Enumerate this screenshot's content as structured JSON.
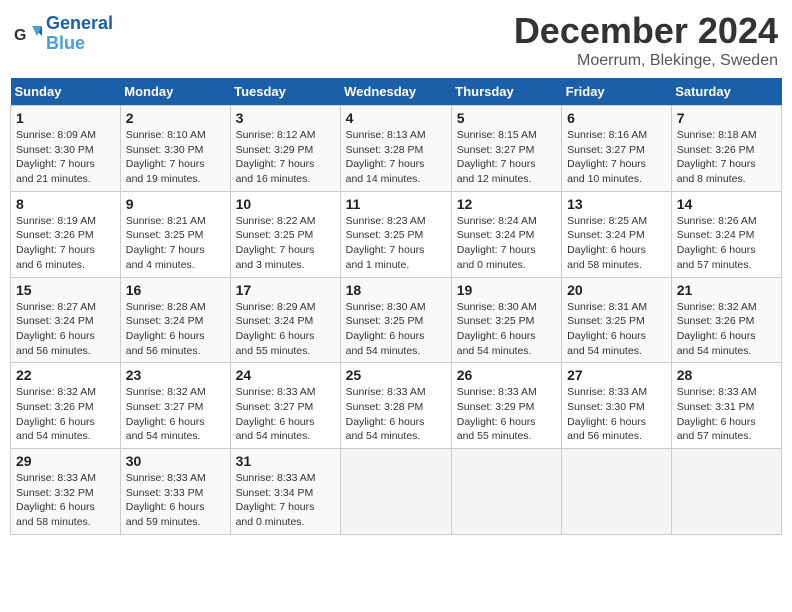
{
  "header": {
    "logo_line1": "General",
    "logo_line2": "Blue",
    "month": "December 2024",
    "location": "Moerrum, Blekinge, Sweden"
  },
  "columns": [
    "Sunday",
    "Monday",
    "Tuesday",
    "Wednesday",
    "Thursday",
    "Friday",
    "Saturday"
  ],
  "weeks": [
    [
      {
        "day": "1",
        "info": "Sunrise: 8:09 AM\nSunset: 3:30 PM\nDaylight: 7 hours\nand 21 minutes."
      },
      {
        "day": "2",
        "info": "Sunrise: 8:10 AM\nSunset: 3:30 PM\nDaylight: 7 hours\nand 19 minutes."
      },
      {
        "day": "3",
        "info": "Sunrise: 8:12 AM\nSunset: 3:29 PM\nDaylight: 7 hours\nand 16 minutes."
      },
      {
        "day": "4",
        "info": "Sunrise: 8:13 AM\nSunset: 3:28 PM\nDaylight: 7 hours\nand 14 minutes."
      },
      {
        "day": "5",
        "info": "Sunrise: 8:15 AM\nSunset: 3:27 PM\nDaylight: 7 hours\nand 12 minutes."
      },
      {
        "day": "6",
        "info": "Sunrise: 8:16 AM\nSunset: 3:27 PM\nDaylight: 7 hours\nand 10 minutes."
      },
      {
        "day": "7",
        "info": "Sunrise: 8:18 AM\nSunset: 3:26 PM\nDaylight: 7 hours\nand 8 minutes."
      }
    ],
    [
      {
        "day": "8",
        "info": "Sunrise: 8:19 AM\nSunset: 3:26 PM\nDaylight: 7 hours\nand 6 minutes."
      },
      {
        "day": "9",
        "info": "Sunrise: 8:21 AM\nSunset: 3:25 PM\nDaylight: 7 hours\nand 4 minutes."
      },
      {
        "day": "10",
        "info": "Sunrise: 8:22 AM\nSunset: 3:25 PM\nDaylight: 7 hours\nand 3 minutes."
      },
      {
        "day": "11",
        "info": "Sunrise: 8:23 AM\nSunset: 3:25 PM\nDaylight: 7 hours\nand 1 minute."
      },
      {
        "day": "12",
        "info": "Sunrise: 8:24 AM\nSunset: 3:24 PM\nDaylight: 7 hours\nand 0 minutes."
      },
      {
        "day": "13",
        "info": "Sunrise: 8:25 AM\nSunset: 3:24 PM\nDaylight: 6 hours\nand 58 minutes."
      },
      {
        "day": "14",
        "info": "Sunrise: 8:26 AM\nSunset: 3:24 PM\nDaylight: 6 hours\nand 57 minutes."
      }
    ],
    [
      {
        "day": "15",
        "info": "Sunrise: 8:27 AM\nSunset: 3:24 PM\nDaylight: 6 hours\nand 56 minutes."
      },
      {
        "day": "16",
        "info": "Sunrise: 8:28 AM\nSunset: 3:24 PM\nDaylight: 6 hours\nand 56 minutes."
      },
      {
        "day": "17",
        "info": "Sunrise: 8:29 AM\nSunset: 3:24 PM\nDaylight: 6 hours\nand 55 minutes."
      },
      {
        "day": "18",
        "info": "Sunrise: 8:30 AM\nSunset: 3:25 PM\nDaylight: 6 hours\nand 54 minutes."
      },
      {
        "day": "19",
        "info": "Sunrise: 8:30 AM\nSunset: 3:25 PM\nDaylight: 6 hours\nand 54 minutes."
      },
      {
        "day": "20",
        "info": "Sunrise: 8:31 AM\nSunset: 3:25 PM\nDaylight: 6 hours\nand 54 minutes."
      },
      {
        "day": "21",
        "info": "Sunrise: 8:32 AM\nSunset: 3:26 PM\nDaylight: 6 hours\nand 54 minutes."
      }
    ],
    [
      {
        "day": "22",
        "info": "Sunrise: 8:32 AM\nSunset: 3:26 PM\nDaylight: 6 hours\nand 54 minutes."
      },
      {
        "day": "23",
        "info": "Sunrise: 8:32 AM\nSunset: 3:27 PM\nDaylight: 6 hours\nand 54 minutes."
      },
      {
        "day": "24",
        "info": "Sunrise: 8:33 AM\nSunset: 3:27 PM\nDaylight: 6 hours\nand 54 minutes."
      },
      {
        "day": "25",
        "info": "Sunrise: 8:33 AM\nSunset: 3:28 PM\nDaylight: 6 hours\nand 54 minutes."
      },
      {
        "day": "26",
        "info": "Sunrise: 8:33 AM\nSunset: 3:29 PM\nDaylight: 6 hours\nand 55 minutes."
      },
      {
        "day": "27",
        "info": "Sunrise: 8:33 AM\nSunset: 3:30 PM\nDaylight: 6 hours\nand 56 minutes."
      },
      {
        "day": "28",
        "info": "Sunrise: 8:33 AM\nSunset: 3:31 PM\nDaylight: 6 hours\nand 57 minutes."
      }
    ],
    [
      {
        "day": "29",
        "info": "Sunrise: 8:33 AM\nSunset: 3:32 PM\nDaylight: 6 hours\nand 58 minutes."
      },
      {
        "day": "30",
        "info": "Sunrise: 8:33 AM\nSunset: 3:33 PM\nDaylight: 6 hours\nand 59 minutes."
      },
      {
        "day": "31",
        "info": "Sunrise: 8:33 AM\nSunset: 3:34 PM\nDaylight: 7 hours\nand 0 minutes."
      },
      {
        "day": "",
        "info": ""
      },
      {
        "day": "",
        "info": ""
      },
      {
        "day": "",
        "info": ""
      },
      {
        "day": "",
        "info": ""
      }
    ]
  ]
}
